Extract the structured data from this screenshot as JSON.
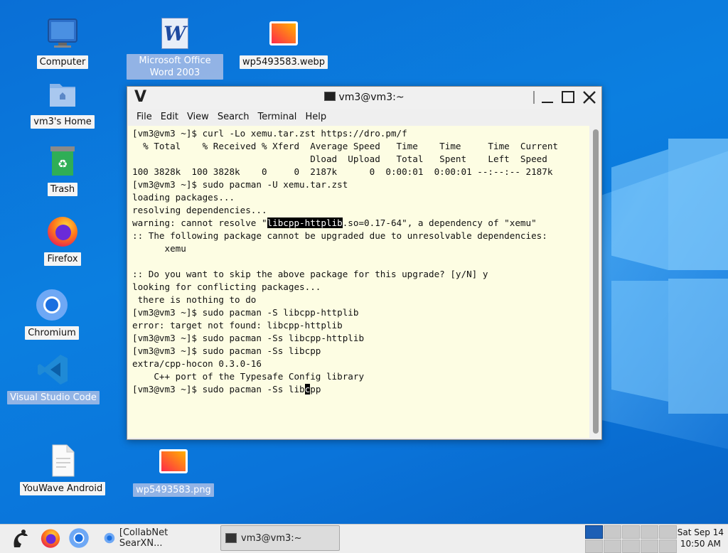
{
  "desktop": {
    "icons": {
      "computer": "Computer",
      "word": "Microsoft Office Word 2003",
      "webp": "wp5493583.webp",
      "home": "vm3's Home",
      "trash": "Trash",
      "firefox": "Firefox",
      "chromium": "Chromium",
      "vscode": "Visual Studio Code",
      "youwave": "YouWave Android",
      "png": "wp5493583.png"
    }
  },
  "terminal": {
    "title": "vm3@vm3:~",
    "menu": [
      "File",
      "Edit",
      "View",
      "Search",
      "Terminal",
      "Help"
    ],
    "lines": [
      "[vm3@vm3 ~]$ curl -Lo xemu.tar.zst https://dro.pm/f",
      "  % Total    % Received % Xferd  Average Speed   Time    Time     Time  Current",
      "                                 Dload  Upload   Total   Spent    Left  Speed",
      "100 3828k  100 3828k    0     0  2187k      0  0:00:01  0:00:01 --:--:-- 2187k",
      "[vm3@vm3 ~]$ sudo pacman -U xemu.tar.zst",
      "loading packages...",
      "resolving dependencies...",
      {
        "pre": "warning: cannot resolve \"",
        "hl": "libcpp-httplib",
        "post": ".so=0.17-64\", a dependency of \"xemu\""
      },
      ":: The following package cannot be upgraded due to unresolvable dependencies:",
      "      xemu",
      "",
      ":: Do you want to skip the above package for this upgrade? [y/N] y",
      "looking for conflicting packages...",
      " there is nothing to do",
      "[vm3@vm3 ~]$ sudo pacman -S libcpp-httplib",
      "error: target not found: libcpp-httplib",
      "[vm3@vm3 ~]$ sudo pacman -Ss libcpp-httplib",
      "[vm3@vm3 ~]$ sudo pacman -Ss libcpp",
      "extra/cpp-hocon 0.3.0-16",
      "    C++ port of the Typesafe Config library",
      {
        "pre": "[vm3@vm3 ~]$ sudo pacman -Ss lib",
        "hl": "c",
        "post": "pp"
      }
    ]
  },
  "taskbar": {
    "collabnet": "[CollabNet SearXN...",
    "terminal": "vm3@vm3:~",
    "clock_day": "Sat Sep 14",
    "clock_time": "10:50 AM"
  },
  "colors": {
    "terminal_bg": "#fdfde3",
    "desktop_bg": "#0a74da"
  }
}
